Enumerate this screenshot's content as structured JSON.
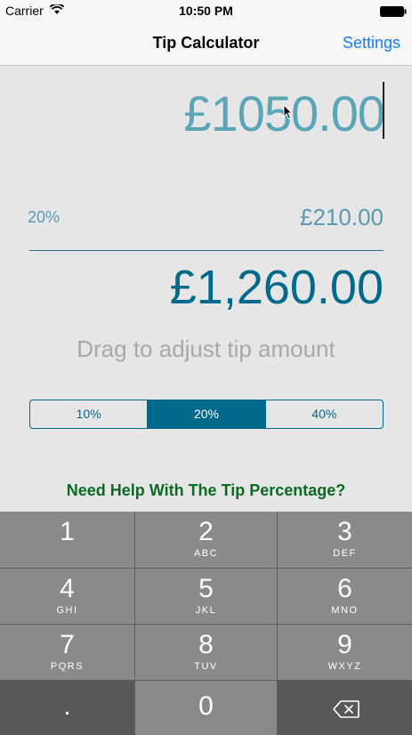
{
  "status_bar": {
    "carrier": "Carrier",
    "time": "10:50 PM"
  },
  "nav": {
    "title": "Tip Calculator",
    "settings_label": "Settings"
  },
  "bill": {
    "value": "£1050.00"
  },
  "tip": {
    "percent": "20%",
    "amount": "£210.00"
  },
  "total": {
    "amount": "£1,260.00"
  },
  "hint": {
    "text": "Drag to adjust tip amount"
  },
  "segments": {
    "options": [
      "10%",
      "20%",
      "40%"
    ],
    "selected": "20%"
  },
  "help": {
    "text": "Need Help With The Tip Percentage?"
  },
  "keypad": {
    "keys": [
      {
        "num": "1",
        "letters": ""
      },
      {
        "num": "2",
        "letters": "ABC"
      },
      {
        "num": "3",
        "letters": "DEF"
      },
      {
        "num": "4",
        "letters": "GHI"
      },
      {
        "num": "5",
        "letters": "JKL"
      },
      {
        "num": "6",
        "letters": "MNO"
      },
      {
        "num": "7",
        "letters": "PQRS"
      },
      {
        "num": "8",
        "letters": "TUV"
      },
      {
        "num": "9",
        "letters": "WXYZ"
      }
    ],
    "dot": ".",
    "zero": "0"
  }
}
